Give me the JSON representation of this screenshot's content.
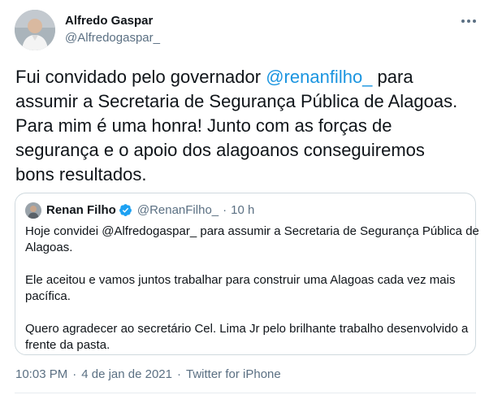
{
  "author": {
    "name": "Alfredo Gaspar",
    "handle": "@Alfredogaspar_"
  },
  "tweet": {
    "lines": [
      {
        "pre": "Fui convidado pelo governador ",
        "mention": "@renanfilho_",
        "post": " para"
      },
      {
        "text": "assumir a Secretaria de Segurança Pública de Alagoas."
      },
      {
        "text": "Para mim é uma honra! Junto com as forças de"
      },
      {
        "text": "segurança e o apoio dos alagoanos conseguiremos"
      },
      {
        "text": "bons resultados."
      }
    ]
  },
  "quote": {
    "name": "Renan Filho",
    "handle": "@RenanFilho_",
    "separator": "·",
    "time": "10 h",
    "paragraphs": [
      [
        "Hoje convidei @Alfredogaspar_ para assumir a Secretaria de Segurança Pública de",
        "Alagoas."
      ],
      [
        "Ele aceitou e vamos juntos trabalhar para construir uma Alagoas cada vez mais",
        "pacífica."
      ],
      [
        "Quero agradecer ao secretário Cel. Lima Jr pelo brilhante trabalho desenvolvido a",
        "frente da pasta."
      ]
    ]
  },
  "meta": {
    "time": "10:03 PM",
    "date": "4 de jan de 2021",
    "separator": "·",
    "source": "Twitter for iPhone"
  },
  "colors": {
    "link": "#1b95e0",
    "secondary_text": "#5b7083",
    "verified": "#1da1f2"
  },
  "icons": {
    "more": "more-horizontal-icon",
    "verified": "verified-badge-icon"
  }
}
